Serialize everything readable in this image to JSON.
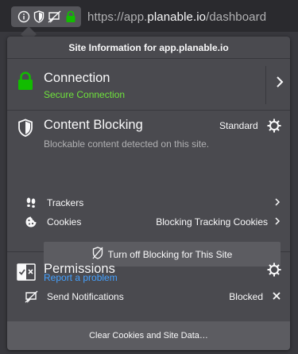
{
  "urlbar": {
    "url_prefix": "https://app.",
    "url_host": "planable.io",
    "url_path": "/dashboard"
  },
  "panel": {
    "title": "Site Information for app.planable.io",
    "connection": {
      "title": "Connection",
      "status": "Secure Connection",
      "status_color": "#6fe23c"
    },
    "content_blocking": {
      "title": "Content Blocking",
      "mode": "Standard",
      "description": "Blockable content detected on this site.",
      "rows": [
        {
          "label": "Trackers",
          "value": "",
          "icon": "footprints-icon"
        },
        {
          "label": "Cookies",
          "value": "Blocking Tracking Cookies",
          "icon": "cookie-icon"
        }
      ],
      "button_label": "Turn off Blocking for This Site",
      "report_link": "Report a problem"
    },
    "permissions": {
      "title": "Permissions",
      "items": [
        {
          "label": "Send Notifications",
          "state": "Blocked",
          "icon": "notification-icon"
        }
      ]
    },
    "footer_button": "Clear Cookies and Site Data…"
  },
  "colors": {
    "panel_bg": "#4a4a4f",
    "accent_link": "#45a1ff",
    "secure_green": "#6fe23c"
  }
}
